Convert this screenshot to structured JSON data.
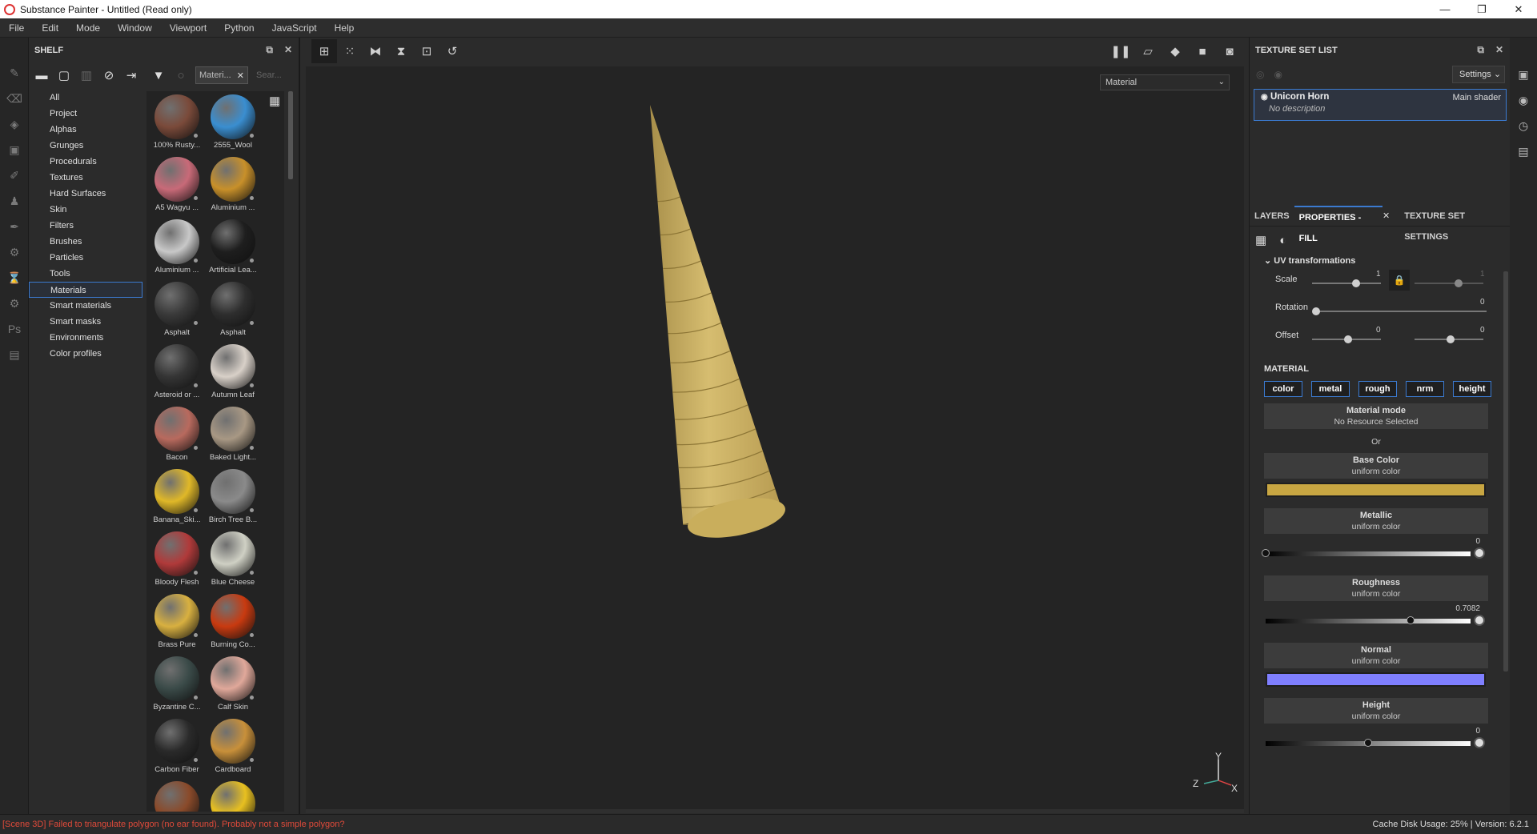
{
  "window": {
    "title": "Substance Painter - Untitled (Read only)",
    "minimize": "—",
    "maximize": "❐",
    "close": "✕"
  },
  "menu": [
    "File",
    "Edit",
    "Mode",
    "Window",
    "Viewport",
    "Python",
    "JavaScript",
    "Help"
  ],
  "shelf": {
    "title": "SHELF",
    "filter_chip": "Materi...",
    "search_placeholder": "Sear...",
    "categories": [
      "All",
      "Project",
      "Alphas",
      "Grunges",
      "Procedurals",
      "Textures",
      "Hard Surfaces",
      "Skin",
      "Filters",
      "Brushes",
      "Particles",
      "Tools",
      "Materials",
      "Smart materials",
      "Smart masks",
      "Environments",
      "Color profiles"
    ],
    "selected_category": "Materials",
    "materials": [
      {
        "name": "100% Rusty...",
        "color": "#7a4a3a"
      },
      {
        "name": "2555_Wool",
        "color": "#3a8ed0"
      },
      {
        "name": "A5 Wagyu ...",
        "color": "#c86a78"
      },
      {
        "name": "Aluminium ...",
        "color": "#c8902a"
      },
      {
        "name": "Aluminium ...",
        "color": "#c8c8c8"
      },
      {
        "name": "Artificial Lea...",
        "color": "#1e1e1e"
      },
      {
        "name": "Asphalt",
        "color": "#3a3a3a"
      },
      {
        "name": "Asphalt",
        "color": "#2e2e2e"
      },
      {
        "name": "Asteroid or ...",
        "color": "#353535"
      },
      {
        "name": "Autumn Leaf",
        "color": "#d8d0c8"
      },
      {
        "name": "Bacon",
        "color": "#b86a5e"
      },
      {
        "name": "Baked Light...",
        "color": "#a89884"
      },
      {
        "name": "Banana_Ski...",
        "color": "#e0b828"
      },
      {
        "name": "Birch Tree B...",
        "color": "#8a8a8a"
      },
      {
        "name": "Bloody Flesh",
        "color": "#b03a3a"
      },
      {
        "name": "Blue Cheese",
        "color": "#cfd0c4"
      },
      {
        "name": "Brass Pure",
        "color": "#d8b040"
      },
      {
        "name": "Burning Co...",
        "color": "#c83a10"
      },
      {
        "name": "Byzantine C...",
        "color": "#3a4a48"
      },
      {
        "name": "Calf Skin",
        "color": "#e0a89a"
      },
      {
        "name": "Carbon Fiber",
        "color": "#2a2a2a"
      },
      {
        "name": "Cardboard",
        "color": "#c8903a"
      },
      {
        "name": "",
        "color": "#8a4a2a"
      },
      {
        "name": "",
        "color": "#e8c020"
      }
    ]
  },
  "viewport": {
    "toolbar_icons": [
      "grid-icon",
      "grid-alt-icon",
      "mirror-x-icon",
      "mirror-y-icon",
      "frame-icon",
      "reset-icon"
    ],
    "right_icons": [
      "pause-icon",
      "perspective-icon",
      "cube-icon",
      "camera-icon",
      "screenshot-icon"
    ],
    "channel": "Material",
    "axis": {
      "x": "X",
      "y": "Y",
      "z": "Z"
    }
  },
  "texture_set_list": {
    "title": "TEXTURE SET LIST",
    "settings_label": "Settings",
    "item": {
      "name": "Unicorn Horn",
      "shader": "Main shader",
      "description": "No description"
    }
  },
  "tabs": [
    "LAYERS",
    "PROPERTIES - FILL",
    "TEXTURE SET SETTINGS"
  ],
  "active_tab": "PROPERTIES - FILL",
  "uv": {
    "title": "UV transformations",
    "scale_label": "Scale",
    "scale_value": "1",
    "scale_value2": "1",
    "rotation_label": "Rotation",
    "rotation_value": "0",
    "offset_label": "Offset",
    "offset_value": "0",
    "offset_value2": "0"
  },
  "material": {
    "title": "MATERIAL",
    "channels": [
      "color",
      "metal",
      "rough",
      "nrm",
      "height"
    ],
    "mode_title": "Material mode",
    "mode_sub": "No Resource Selected",
    "or": "Or",
    "base_color": {
      "title": "Base Color",
      "sub": "uniform color",
      "swatch": "#c8a642"
    },
    "metallic": {
      "title": "Metallic",
      "sub": "uniform color",
      "value": "0",
      "level": 0
    },
    "roughness": {
      "title": "Roughness",
      "sub": "uniform color",
      "value": "0.7082",
      "level": 0.7082
    },
    "normal": {
      "title": "Normal",
      "sub": "uniform color",
      "swatch": "#7f7fff"
    },
    "height": {
      "title": "Height",
      "sub": "uniform color",
      "value": "0",
      "level": 0.5
    }
  },
  "status": {
    "error": "[Scene 3D] Failed to triangulate polygon (no ear found). Probably not a simple polygon?",
    "right": "Cache Disk Usage:   25% | Version: 6.2.1"
  }
}
